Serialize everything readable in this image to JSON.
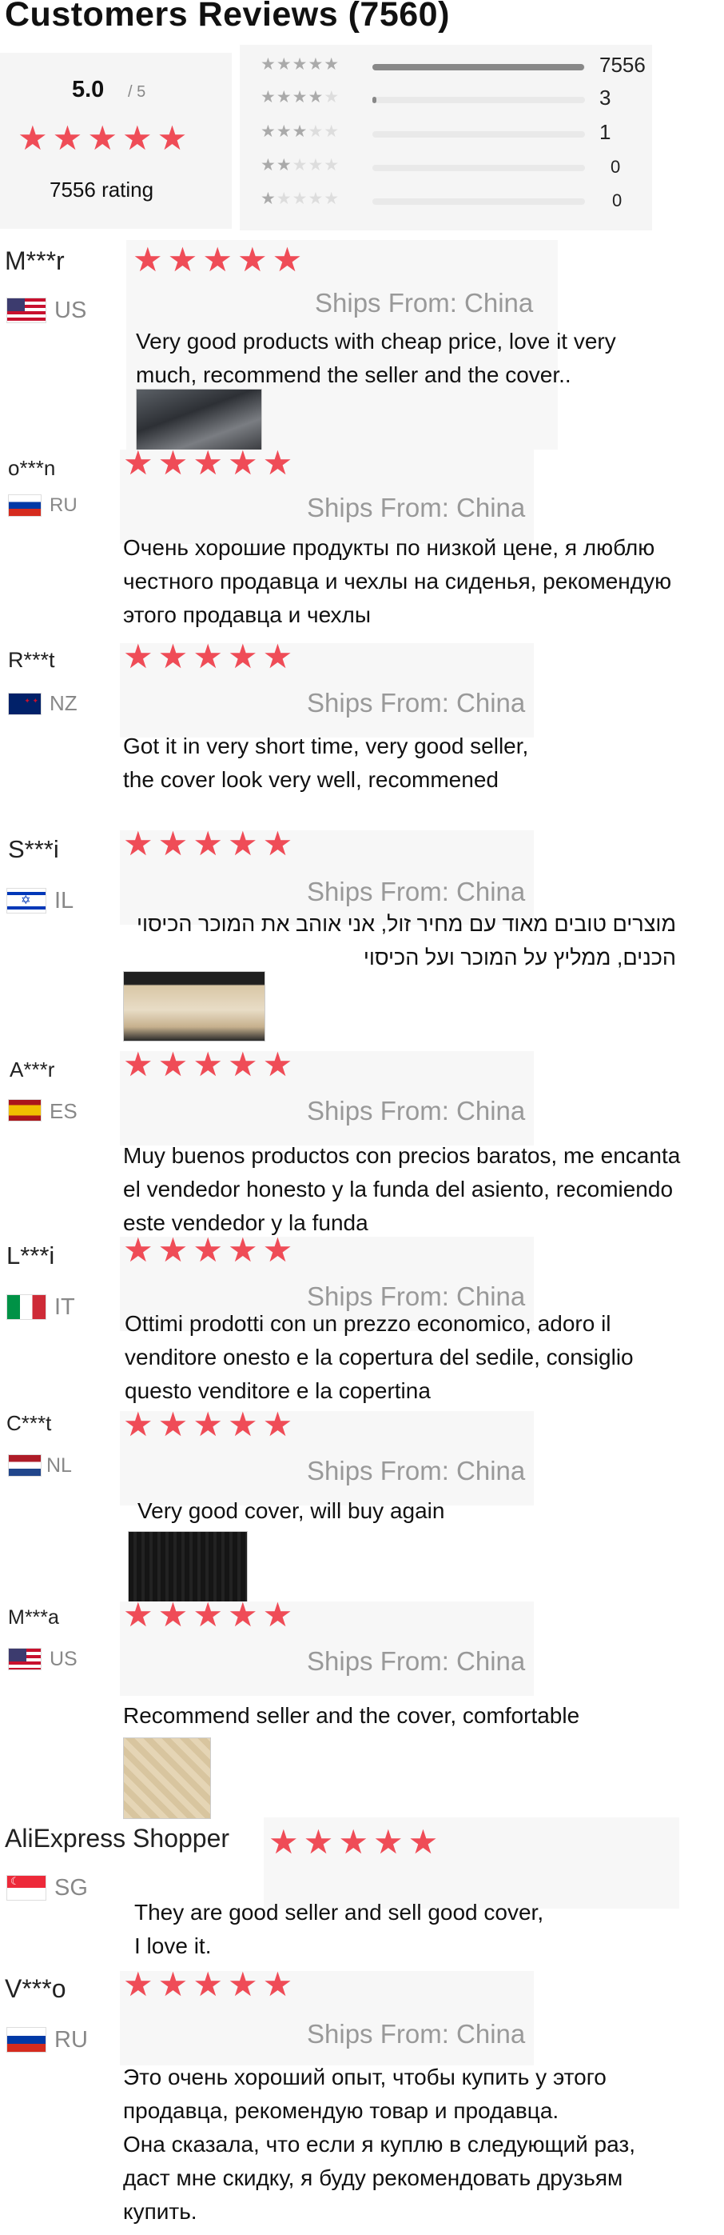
{
  "header": {
    "title": "Customers Reviews (7560)"
  },
  "summary": {
    "score": "5.0",
    "score_of": "/ 5",
    "rating_count": "7556 rating",
    "breakdown": [
      {
        "stars": 5,
        "count": "7556",
        "fraction": 0.995
      },
      {
        "stars": 4,
        "count": "3",
        "fraction": 0.02
      },
      {
        "stars": 3,
        "count": "1",
        "fraction": 0.0
      },
      {
        "stars": 2,
        "count": "0",
        "fraction": 0.0
      },
      {
        "stars": 1,
        "count": "0",
        "fraction": 0.0
      }
    ]
  },
  "ships_label": "Ships From: China",
  "reviews": [
    {
      "name": "M***r",
      "country": "US",
      "flag": "us-flag-icon",
      "stars": 5,
      "text": "Very good products with cheap price, love it very\nmuch, recommend the seller and the cover..",
      "has_photo": true
    },
    {
      "name": "o***n",
      "country": "RU",
      "flag": "ru-flag-icon",
      "stars": 5,
      "text": "Очень хорошие продукты по низкой цене, я люблю\n честного продавца и чехлы на сиденья, рекомендую\nэтого продавца и чехлы",
      "has_photo": false
    },
    {
      "name": "R***t",
      "country": "NZ",
      "flag": "nz-flag-icon",
      "stars": 5,
      "text": "Got it in very short time, very good seller,\nthe cover look very well, recommened",
      "has_photo": false
    },
    {
      "name": "S***i",
      "country": "IL",
      "flag": "il-flag-icon",
      "stars": 5,
      "text": "מוצרים טובים מאוד עם מחיר זול, אני אוהב את המוכר הכיסוי\nהכנים, ממליץ על המוכר ועל הכיסוי",
      "has_photo": true
    },
    {
      "name": "A***r",
      "country": "ES",
      "flag": "es-flag-icon",
      "stars": 5,
      "text": "Muy buenos productos con precios baratos, me encanta\nel vendedor honesto y la funda del asiento, recomiendo\n este vendedor y la funda",
      "has_photo": false
    },
    {
      "name": "L***i",
      "country": "IT",
      "flag": "it-flag-icon",
      "stars": 5,
      "text": "Ottimi prodotti con un prezzo economico, adoro il\nvenditore onesto e la copertura del sedile, consiglio\nquesto venditore e la copertina",
      "has_photo": false
    },
    {
      "name": "C***t",
      "country": "NL",
      "flag": "nl-flag-icon",
      "stars": 5,
      "text": "Very good cover, will buy again",
      "has_photo": true
    },
    {
      "name": "M***a",
      "country": "US",
      "flag": "us-flag-icon",
      "stars": 5,
      "text": "Recommend seller and the cover, comfortable",
      "has_photo": true
    },
    {
      "name": "AliExpress Shopper",
      "country": "SG",
      "flag": "sg-flag-icon",
      "stars": 5,
      "text": "They are good seller and sell good cover,\nI love it.",
      "has_photo": false
    },
    {
      "name": "V***o",
      "country": "RU",
      "flag": "ru-flag-icon",
      "stars": 5,
      "text": "Это очень хороший опыт, чтобы купить у этого\nпродавца, рекомендую товар и продавца.\nОна сказала, что если я куплю в следующий раз,\nдаст мне скидку, я буду рекомендовать друзьям\nкупить.",
      "has_photo": false
    }
  ],
  "colors": {
    "star": "#ef4c57",
    "muted": "#999999",
    "bar_fill": "#888888"
  }
}
